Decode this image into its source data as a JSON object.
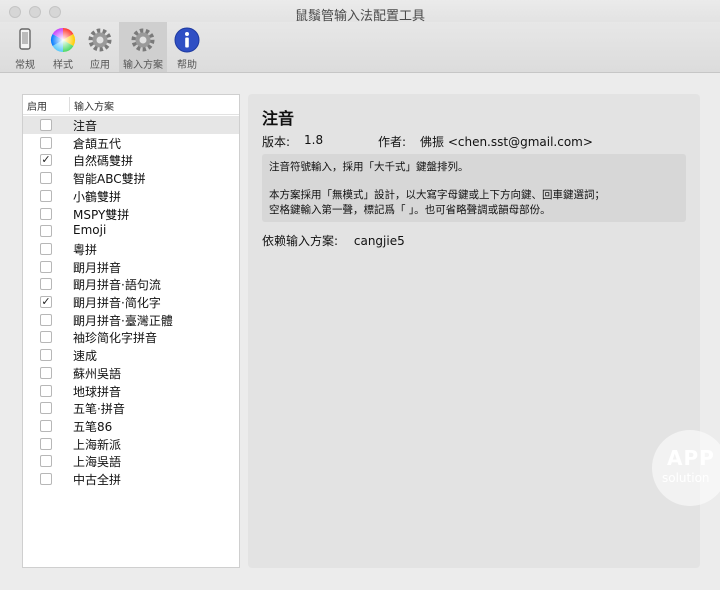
{
  "window": {
    "title": "鼠鬚管输入法配置工具"
  },
  "toolbar": {
    "items": [
      {
        "label": "常规",
        "icon": "phone-icon"
      },
      {
        "label": "样式",
        "icon": "color-wheel-icon"
      },
      {
        "label": "应用",
        "icon": "gear-icon"
      },
      {
        "label": "输入方案",
        "icon": "gear-icon",
        "active": true
      },
      {
        "label": "帮助",
        "icon": "info-icon"
      }
    ]
  },
  "schemes": {
    "header_enabled": "启用",
    "header_name": "输入方案",
    "items": [
      {
        "label": "注音",
        "checked": false,
        "selected": true
      },
      {
        "label": "倉頡五代",
        "checked": false
      },
      {
        "label": "自然碼雙拼",
        "checked": true
      },
      {
        "label": "智能ABC雙拼",
        "checked": false
      },
      {
        "label": "小鶴雙拼",
        "checked": false
      },
      {
        "label": "MSPY雙拼",
        "checked": false
      },
      {
        "label": "Emoji",
        "checked": false
      },
      {
        "label": "粵拼",
        "checked": false
      },
      {
        "label": "朙月拼音",
        "checked": false
      },
      {
        "label": "朙月拼音·語句流",
        "checked": false
      },
      {
        "label": "朙月拼音·简化字",
        "checked": true
      },
      {
        "label": "朙月拼音·臺灣正體",
        "checked": false
      },
      {
        "label": "袖珍简化字拼音",
        "checked": false
      },
      {
        "label": "速成",
        "checked": false
      },
      {
        "label": "蘇州吳語",
        "checked": false
      },
      {
        "label": "地球拼音",
        "checked": false
      },
      {
        "label": "五笔·拼音",
        "checked": false
      },
      {
        "label": "五笔86",
        "checked": false
      },
      {
        "label": "上海新派",
        "checked": false
      },
      {
        "label": "上海吳語",
        "checked": false
      },
      {
        "label": "中古全拼",
        "checked": false
      }
    ]
  },
  "detail": {
    "title": "注音",
    "version_label": "版本:",
    "version": "1.8",
    "author_label": "作者:",
    "author": "佛振 <chen.sst@gmail.com>",
    "desc_line1": "注音符號輸入，採用「大千式」鍵盤排列。",
    "desc_line2": "本方案採用「無模式」設計，以大寫字母鍵或上下方向鍵、回車鍵選詞；",
    "desc_line3": "空格鍵輸入第一聲，標記爲「 」。也可省略聲調或韻母部份。",
    "deps_label": "依赖输入方案:",
    "deps_value": "cangjie5"
  },
  "watermark": {
    "line1": "APP",
    "line2": "solution"
  }
}
